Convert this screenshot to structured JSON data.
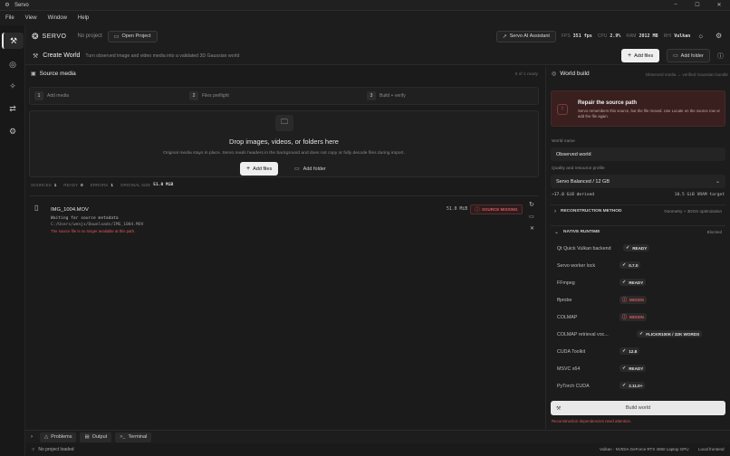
{
  "app": {
    "title": "Servo"
  },
  "window_controls": {
    "minimize": "–",
    "maximize": "☐",
    "close": "✕"
  },
  "menu": [
    "File",
    "View",
    "Window",
    "Help"
  ],
  "topbar": {
    "brand": "SERVO",
    "project": "No project",
    "open_project": "Open Project",
    "ai_assistant": "Servo AI Assistant",
    "fps_label": "FPS",
    "fps_value": "351 fps",
    "cpu_label": "CPU",
    "cpu_value": "2.9%",
    "ram_label": "RAM",
    "ram_value": "2012 MB",
    "rhi_label": "RHI",
    "rhi_value": "Vulkan"
  },
  "header": {
    "title": "Create World",
    "subtitle": "Turn observed image and video media into a validated 3D Gaussian world",
    "add_files": "Add files",
    "add_folder": "Add folder"
  },
  "source": {
    "title": "Source media",
    "ready_count": "0 of 1 ready",
    "steps": [
      {
        "num": "1",
        "label": "Add media"
      },
      {
        "num": "2",
        "label": "Files preflight"
      },
      {
        "num": "3",
        "label": "Build + verify"
      }
    ],
    "drop_title": "Drop images, videos, or folders here",
    "drop_sub": "Original media stays in place. Servo reads headers in the background and does not copy or fully decode files during import.",
    "add_files": "Add files",
    "add_folder": "Add folder",
    "stats": {
      "sources_label": "SOURCES",
      "sources": "1",
      "ready_label": "READY",
      "ready": "0",
      "errors_label": "ERRORS",
      "errors": "1",
      "size_label": "ORIGINAL SIZE",
      "size": "51.0 MiB"
    },
    "file": {
      "name": "IMG_1004.MOV",
      "status": "Waiting for source metadata",
      "path": "C:/Users/wenjx/Downloads/IMG_1004.MOV",
      "error": "The source file is no longer available at this path.",
      "size": "51.0 MiB",
      "badge": "SOURCE MISSING"
    }
  },
  "world": {
    "title": "World build",
    "subtitle": "Observed media → verified Gaussian bundle",
    "alert_title": "Repair the source path",
    "alert_text": "Servo remembers this source, but the file moved. Use Locate on the source row or add the file again.",
    "name_label": "World name",
    "name_value": "Observed world",
    "profile_label": "Quality and resource profile",
    "profile_value": "Servo Balanced / 12 GB",
    "derived": "~17.0 GiB derived",
    "vram": "10.5 GiB VRAM target",
    "recon_label": "RECONSTRUCTION METHOD",
    "recon_value": "Geometry + 3DGS optimization",
    "runtime_label": "NATIVE RUNTIME",
    "runtime_status": "Blocked",
    "runtime": [
      {
        "name": "Qt Quick Vulkan backend",
        "value": "READY",
        "state": "ok"
      },
      {
        "name": "Servo worker lock",
        "value": "0.7.0",
        "state": "ok"
      },
      {
        "name": "FFmpeg",
        "value": "READY",
        "state": "ok"
      },
      {
        "name": "ffprobe",
        "value": "MISSIN",
        "state": "missing"
      },
      {
        "name": "COLMAP",
        "value": "MISSIN",
        "state": "missing"
      },
      {
        "name": "COLMAP retrieval voc...",
        "value": "FLICKR100K / 32K WORDS",
        "state": "ok"
      },
      {
        "name": "CUDA Toolkit",
        "value": "12.8",
        "state": "ok"
      },
      {
        "name": "MSVC x64",
        "value": "READY",
        "state": "ok"
      },
      {
        "name": "PyTorch CUDA",
        "value": "2.11.0+",
        "state": "ok"
      }
    ],
    "build_button": "Build world",
    "build_note": "Reconstruction dependencies need attention."
  },
  "bottom": {
    "problems": "Problems",
    "output": "Output",
    "terminal": "Terminal"
  },
  "status": {
    "project": "No project loaded",
    "gpu": "Vulkan · NVIDIA GeForce RTX 4060 Laptop GPU",
    "mode": "Local frontend"
  },
  "colors": {
    "accent_red": "#e0565a",
    "alert_bg": "#3a1f1f",
    "button_light": "#efefef"
  }
}
